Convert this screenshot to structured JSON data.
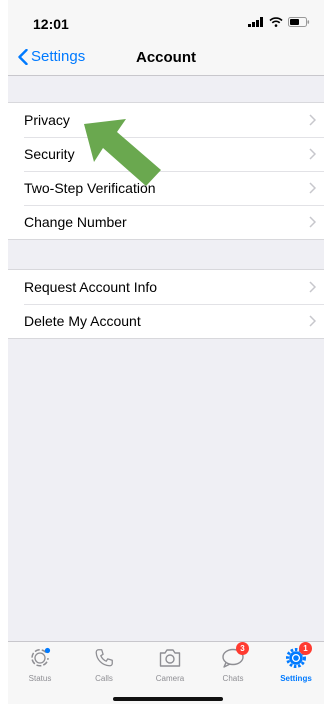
{
  "status_bar": {
    "time": "12:01"
  },
  "nav": {
    "back_label": "Settings",
    "title": "Account"
  },
  "groups": [
    {
      "rows": [
        {
          "label": "Privacy"
        },
        {
          "label": "Security"
        },
        {
          "label": "Two-Step Verification"
        },
        {
          "label": "Change Number"
        }
      ]
    },
    {
      "rows": [
        {
          "label": "Request Account Info"
        },
        {
          "label": "Delete My Account"
        }
      ]
    }
  ],
  "tab_bar": {
    "tabs": [
      {
        "label": "Status",
        "icon": "status-icon",
        "badge": ""
      },
      {
        "label": "Calls",
        "icon": "phone-icon",
        "badge": ""
      },
      {
        "label": "Camera",
        "icon": "camera-icon",
        "badge": ""
      },
      {
        "label": "Chats",
        "icon": "chat-bubble-icon",
        "badge": "3"
      },
      {
        "label": "Settings",
        "icon": "gear-icon",
        "badge": "1",
        "active": true
      }
    ]
  },
  "colors": {
    "accent": "#007aff",
    "badge": "#ff3b30",
    "annotation_arrow": "#6aa84f"
  }
}
